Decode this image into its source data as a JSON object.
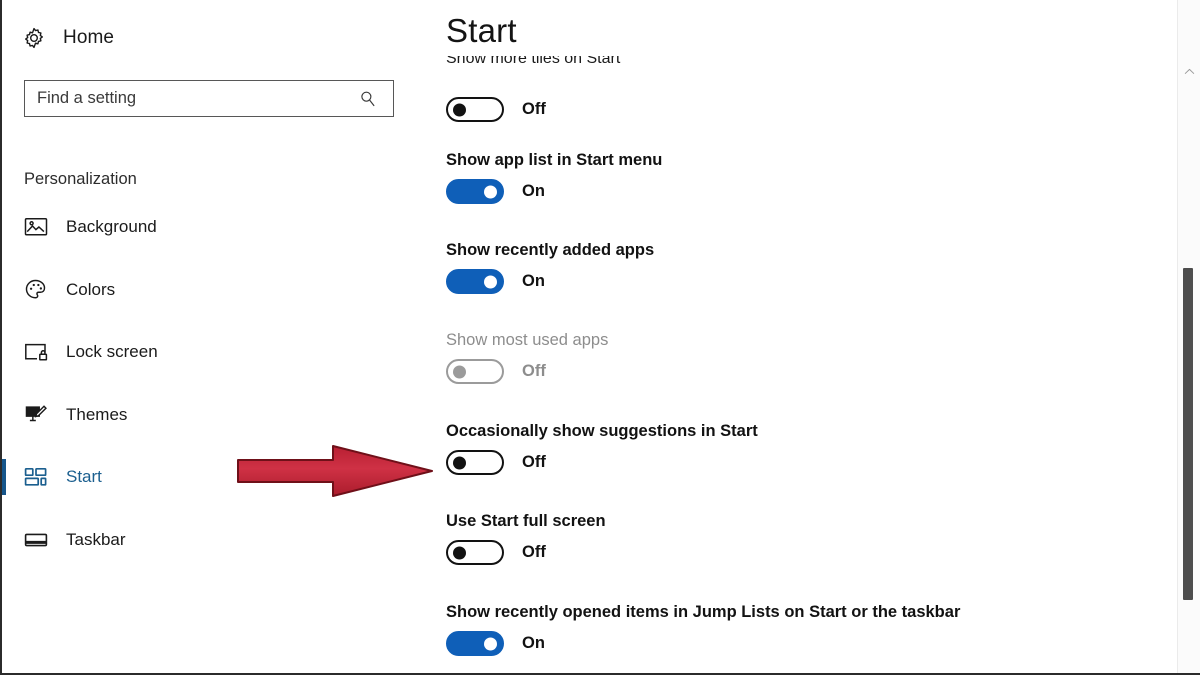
{
  "sidebar": {
    "home": {
      "label": "Home",
      "icon": "gear-icon"
    },
    "search": {
      "value": "",
      "placeholder": "Find a setting",
      "icon": "search-icon"
    },
    "group_title": "Personalization",
    "items": [
      {
        "label": "Background",
        "icon": "picture-icon",
        "selected": false
      },
      {
        "label": "Colors",
        "icon": "palette-icon",
        "selected": false
      },
      {
        "label": "Lock screen",
        "icon": "lock-screen-icon",
        "selected": false
      },
      {
        "label": "Themes",
        "icon": "themes-brush-icon",
        "selected": false
      },
      {
        "label": "Start",
        "icon": "start-tiles-icon",
        "selected": true
      },
      {
        "label": "Taskbar",
        "icon": "taskbar-icon",
        "selected": false
      }
    ]
  },
  "content": {
    "title": "Start",
    "settings": [
      {
        "label": "Show more tiles on Start",
        "state": "Off",
        "on": false,
        "disabled": false,
        "clipped": true
      },
      {
        "label": "Show app list in Start menu",
        "state": "On",
        "on": true,
        "disabled": false,
        "clipped": false
      },
      {
        "label": "Show recently added apps",
        "state": "On",
        "on": true,
        "disabled": false,
        "clipped": false
      },
      {
        "label": "Show most used apps",
        "state": "Off",
        "on": false,
        "disabled": true,
        "clipped": false
      },
      {
        "label": "Occasionally show suggestions in Start",
        "state": "Off",
        "on": false,
        "disabled": false,
        "clipped": false
      },
      {
        "label": "Use Start full screen",
        "state": "Off",
        "on": false,
        "disabled": false,
        "clipped": false
      },
      {
        "label": "Show recently opened items in Jump Lists on Start or the taskbar",
        "state": "On",
        "on": true,
        "disabled": false,
        "clipped": false
      }
    ]
  },
  "scrollbar": {
    "up_arrow_icon": "chevron-up-icon"
  },
  "annotation": {
    "type": "red-arrow",
    "points_to": "Occasionally show suggestions in Start",
    "color": "#c4283c",
    "outline_color": "#7c1622"
  },
  "colors": {
    "accent_blue": "#0f5fb8",
    "selected_nav_blue": "#1b5f8f",
    "accent_bar": "#16558a",
    "text": "#121212",
    "disabled_text": "#8d8d8d",
    "annotation_red": "#c4283c"
  }
}
